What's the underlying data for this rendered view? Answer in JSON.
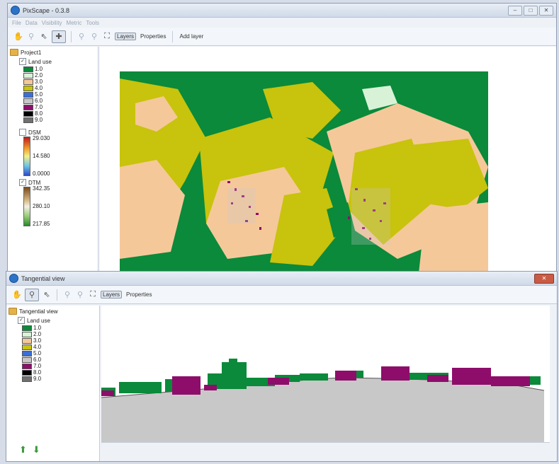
{
  "main_window": {
    "title": "PixScape - 0.3.8",
    "menu": [
      "File",
      "Data",
      "Visibility",
      "Metric",
      "Tools"
    ],
    "toolbar": {
      "layers_label": "Layers",
      "properties_label": "Properties",
      "add_layer_label": "Add layer"
    },
    "layer_tree": {
      "root": "Project1",
      "land_use": {
        "name": "Land use",
        "checked": true,
        "classes": [
          {
            "label": "1.0",
            "color": "#0a8a3a"
          },
          {
            "label": "2.0",
            "color": "#d8f2d8"
          },
          {
            "label": "3.0",
            "color": "#f5c89a"
          },
          {
            "label": "4.0",
            "color": "#c8c30c"
          },
          {
            "label": "5.0",
            "color": "#3a6fd8"
          },
          {
            "label": "6.0",
            "color": "#c8c8c8"
          },
          {
            "label": "7.0",
            "color": "#8e0d6b"
          },
          {
            "label": "8.0",
            "color": "#000000"
          },
          {
            "label": "9.0",
            "color": "#707070"
          }
        ]
      },
      "dsm": {
        "name": "DSM",
        "checked": false,
        "max": "29.030",
        "mid": "14.580",
        "min": "0.0000"
      },
      "dtm": {
        "name": "DTM",
        "checked": true,
        "max": "342.35",
        "mid": "280.10",
        "min": "217.85"
      }
    }
  },
  "tangential_window": {
    "title": "Tangential view",
    "toolbar": {
      "layers_label": "Layers",
      "properties_label": "Properties"
    },
    "layer_tree": {
      "root": "Tangential view",
      "land_use": {
        "name": "Land use",
        "checked": true,
        "classes": [
          {
            "label": "1.0",
            "color": "#0a8a3a"
          },
          {
            "label": "2.0",
            "color": "#d8f2d8"
          },
          {
            "label": "3.0",
            "color": "#f5c89a"
          },
          {
            "label": "4.0",
            "color": "#c8c30c"
          },
          {
            "label": "5.0",
            "color": "#3a6fd8"
          },
          {
            "label": "6.0",
            "color": "#c8c8c8"
          },
          {
            "label": "7.0",
            "color": "#8e0d6b"
          },
          {
            "label": "8.0",
            "color": "#000000"
          },
          {
            "label": "9.0",
            "color": "#707070"
          }
        ]
      }
    }
  },
  "icons": {
    "pan": "hand-icon",
    "zoom": "magnifier-icon",
    "select": "pointer-icon",
    "add_point": "crosshair-icon",
    "up": "arrow-up-icon",
    "down": "arrow-down-icon"
  }
}
